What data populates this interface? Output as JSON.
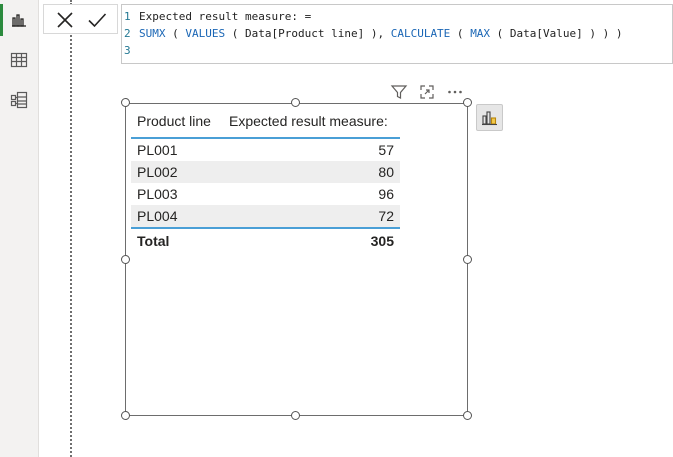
{
  "formula": {
    "lines": [
      {
        "num": "1",
        "text": "Expected result measure: ="
      },
      {
        "num": "2",
        "tokens": [
          "SUMX",
          " ( ",
          "VALUES",
          " ( Data[Product line] ), ",
          "CALCULATE",
          " ( ",
          "MAX",
          " ( Data[Value] ) ) )"
        ]
      },
      {
        "num": "3",
        "text": ""
      }
    ]
  },
  "table": {
    "headers": [
      "Product line",
      "Expected result measure:"
    ],
    "rows": [
      [
        "PL001",
        "57"
      ],
      [
        "PL002",
        "80"
      ],
      [
        "PL003",
        "96"
      ],
      [
        "PL004",
        "72"
      ]
    ],
    "total": [
      "Total",
      "305"
    ]
  },
  "colors": {
    "accent_blue": "#4a9fd6",
    "function_blue": "#1a66b5",
    "line_number": "#237893",
    "report_view_active": "#2b8a3e"
  },
  "icons": {
    "rail": [
      "report-view-icon",
      "table-view-icon",
      "model-view-icon"
    ],
    "formula_actions": [
      "cancel-icon",
      "commit-icon"
    ],
    "visual_header": [
      "filter-icon",
      "focus-mode-icon",
      "more-options-icon"
    ],
    "side_pane": "format-pane-icon"
  }
}
